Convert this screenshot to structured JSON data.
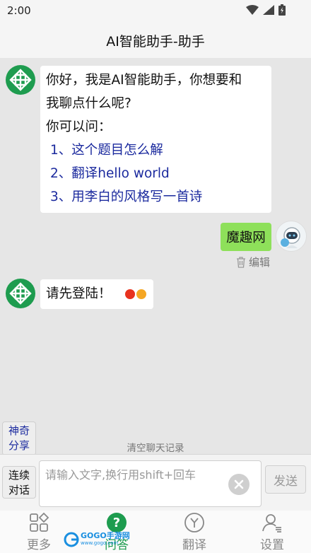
{
  "status_bar": {
    "time": "2:00",
    "icons": [
      "wifi-icon",
      "signal-icon",
      "battery-icon"
    ]
  },
  "header": {
    "title": "AI智能助手-助手"
  },
  "chat": {
    "bot_welcome": {
      "lines": [
        "你好，我是AI智能助手，你想要和",
        "我聊点什么呢?",
        "你可以问："
      ],
      "suggestions": [
        "1、这个题目怎么解",
        "2、翻译hello world",
        "3、用李白的风格写一首诗"
      ]
    },
    "user_message": {
      "text": "魔趣网",
      "edit_label": "编辑"
    },
    "bot_reply": {
      "text": "请先登陆！"
    }
  },
  "side_buttons": {
    "magic_share": [
      "神奇",
      "分享"
    ],
    "continuous_chat": [
      "连续",
      "对话"
    ]
  },
  "clear_history_label": "清空聊天记录",
  "input": {
    "placeholder": "请输入文字,换行用shift+回车",
    "value": "",
    "send_label": "发送"
  },
  "bottom_nav": [
    {
      "label": "更多",
      "icon": "grid-icon",
      "active": false
    },
    {
      "label": "问答",
      "icon": "question-icon",
      "active": true
    },
    {
      "label": "翻译",
      "icon": "translate-icon",
      "active": false
    },
    {
      "label": "设置",
      "icon": "user-settings-icon",
      "active": false
    }
  ],
  "watermark": {
    "text": "GOGO手游网",
    "url_text": "www.gogo.com"
  },
  "colors": {
    "brand_green": "#1e9c4f",
    "user_bubble": "#8ee05a",
    "suggestion_blue": "#1b2a9e",
    "dot_red": "#e8321e",
    "dot_orange": "#f5a623"
  }
}
